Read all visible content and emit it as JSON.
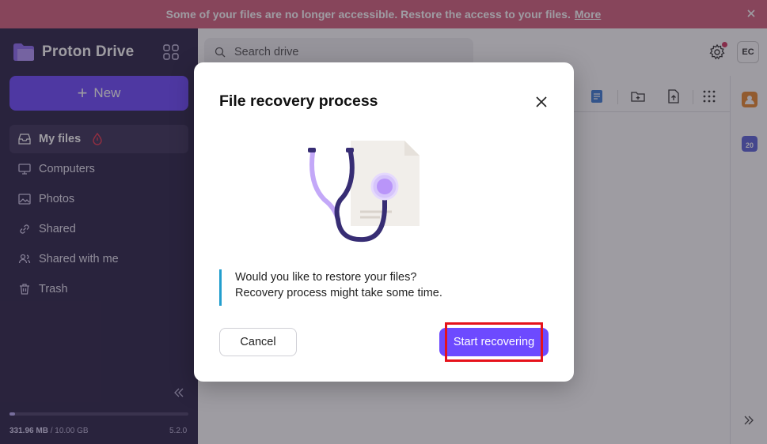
{
  "banner": {
    "message": "Some of your files are no longer accessible. Restore the access to your files.",
    "more_link": "More"
  },
  "app": {
    "name": "Proton Drive"
  },
  "sidebar": {
    "new_label": "New",
    "items": [
      {
        "label": "My files",
        "icon": "inbox-icon",
        "active": true
      },
      {
        "label": "Computers",
        "icon": "monitor-icon"
      },
      {
        "label": "Photos",
        "icon": "image-icon"
      },
      {
        "label": "Shared",
        "icon": "link-icon"
      },
      {
        "label": "Shared with me",
        "icon": "users-icon"
      },
      {
        "label": "Trash",
        "icon": "trash-icon"
      }
    ],
    "storage": {
      "used": "331.96 MB",
      "separator": " / ",
      "total": "10.00 GB",
      "fraction_used": 0.033
    },
    "version": "5.2.0"
  },
  "header": {
    "search_placeholder": "Search drive",
    "avatar_initials": "EC"
  },
  "modal": {
    "title": "File recovery process",
    "line1": "Would you like to restore your files?",
    "line2": "Recovery process might take some time.",
    "cancel_label": "Cancel",
    "confirm_label": "Start recovering"
  },
  "colors": {
    "banner": "#d6617e",
    "sidebar": "#2b2347",
    "accent": "#6d4aff",
    "info_border": "#239ece",
    "highlight": "#e6121b"
  }
}
